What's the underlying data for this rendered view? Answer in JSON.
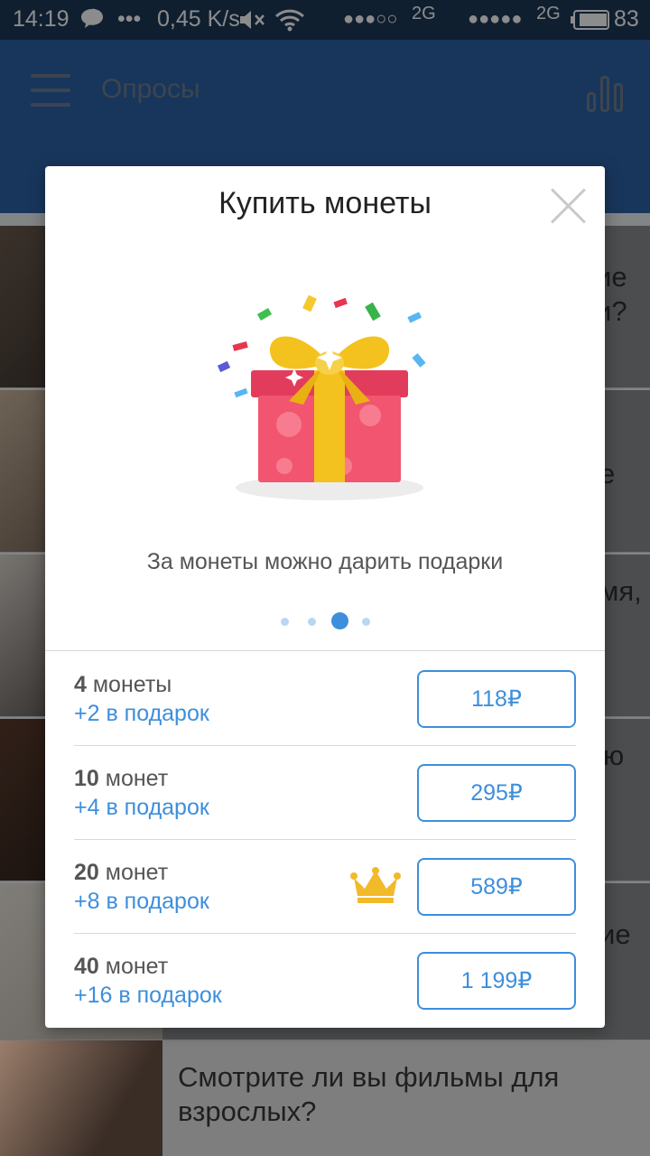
{
  "status_bar": {
    "time": "14:19",
    "dots": "•••",
    "speed": "0,45 K/s",
    "signal1": "●●●○○",
    "net1": "2G",
    "signal2": "●●●●●",
    "net2": "2G",
    "battery": "83"
  },
  "appbar": {
    "title": "Опросы",
    "menu_icon": "hamburger-menu-icon",
    "stats_icon": "bar-chart-icon"
  },
  "background_list": {
    "rows": [
      {
        "text": "ие\nи?"
      },
      {
        "text": "е"
      },
      {
        "text": "мя,"
      },
      {
        "text": "ю"
      },
      {
        "text": "ие"
      }
    ],
    "last_row_text": "Смотрите ли вы фильмы для взрослых?"
  },
  "dialog": {
    "title": "Купить монеты",
    "close_icon": "close-icon",
    "gift_icon": "gift-box-icon",
    "caption": "За монеты можно дарить подарки",
    "page_dots": {
      "count": 4,
      "active_index": 2
    },
    "offers": [
      {
        "amount": "4",
        "unit": " монеты",
        "bonus": "+2 в подарок",
        "price": "118₽",
        "best": false
      },
      {
        "amount": "10",
        "unit": " монет",
        "bonus": "+4 в подарок",
        "price": "295₽",
        "best": false
      },
      {
        "amount": "20",
        "unit": " монет",
        "bonus": "+8 в подарок",
        "price": "589₽",
        "best": true
      },
      {
        "amount": "40",
        "unit": " монет",
        "bonus": "+16 в подарок",
        "price": "1 199₽",
        "best": false
      }
    ],
    "colors": {
      "accent": "#3d8fdc",
      "crown": "#f2b92b"
    }
  }
}
